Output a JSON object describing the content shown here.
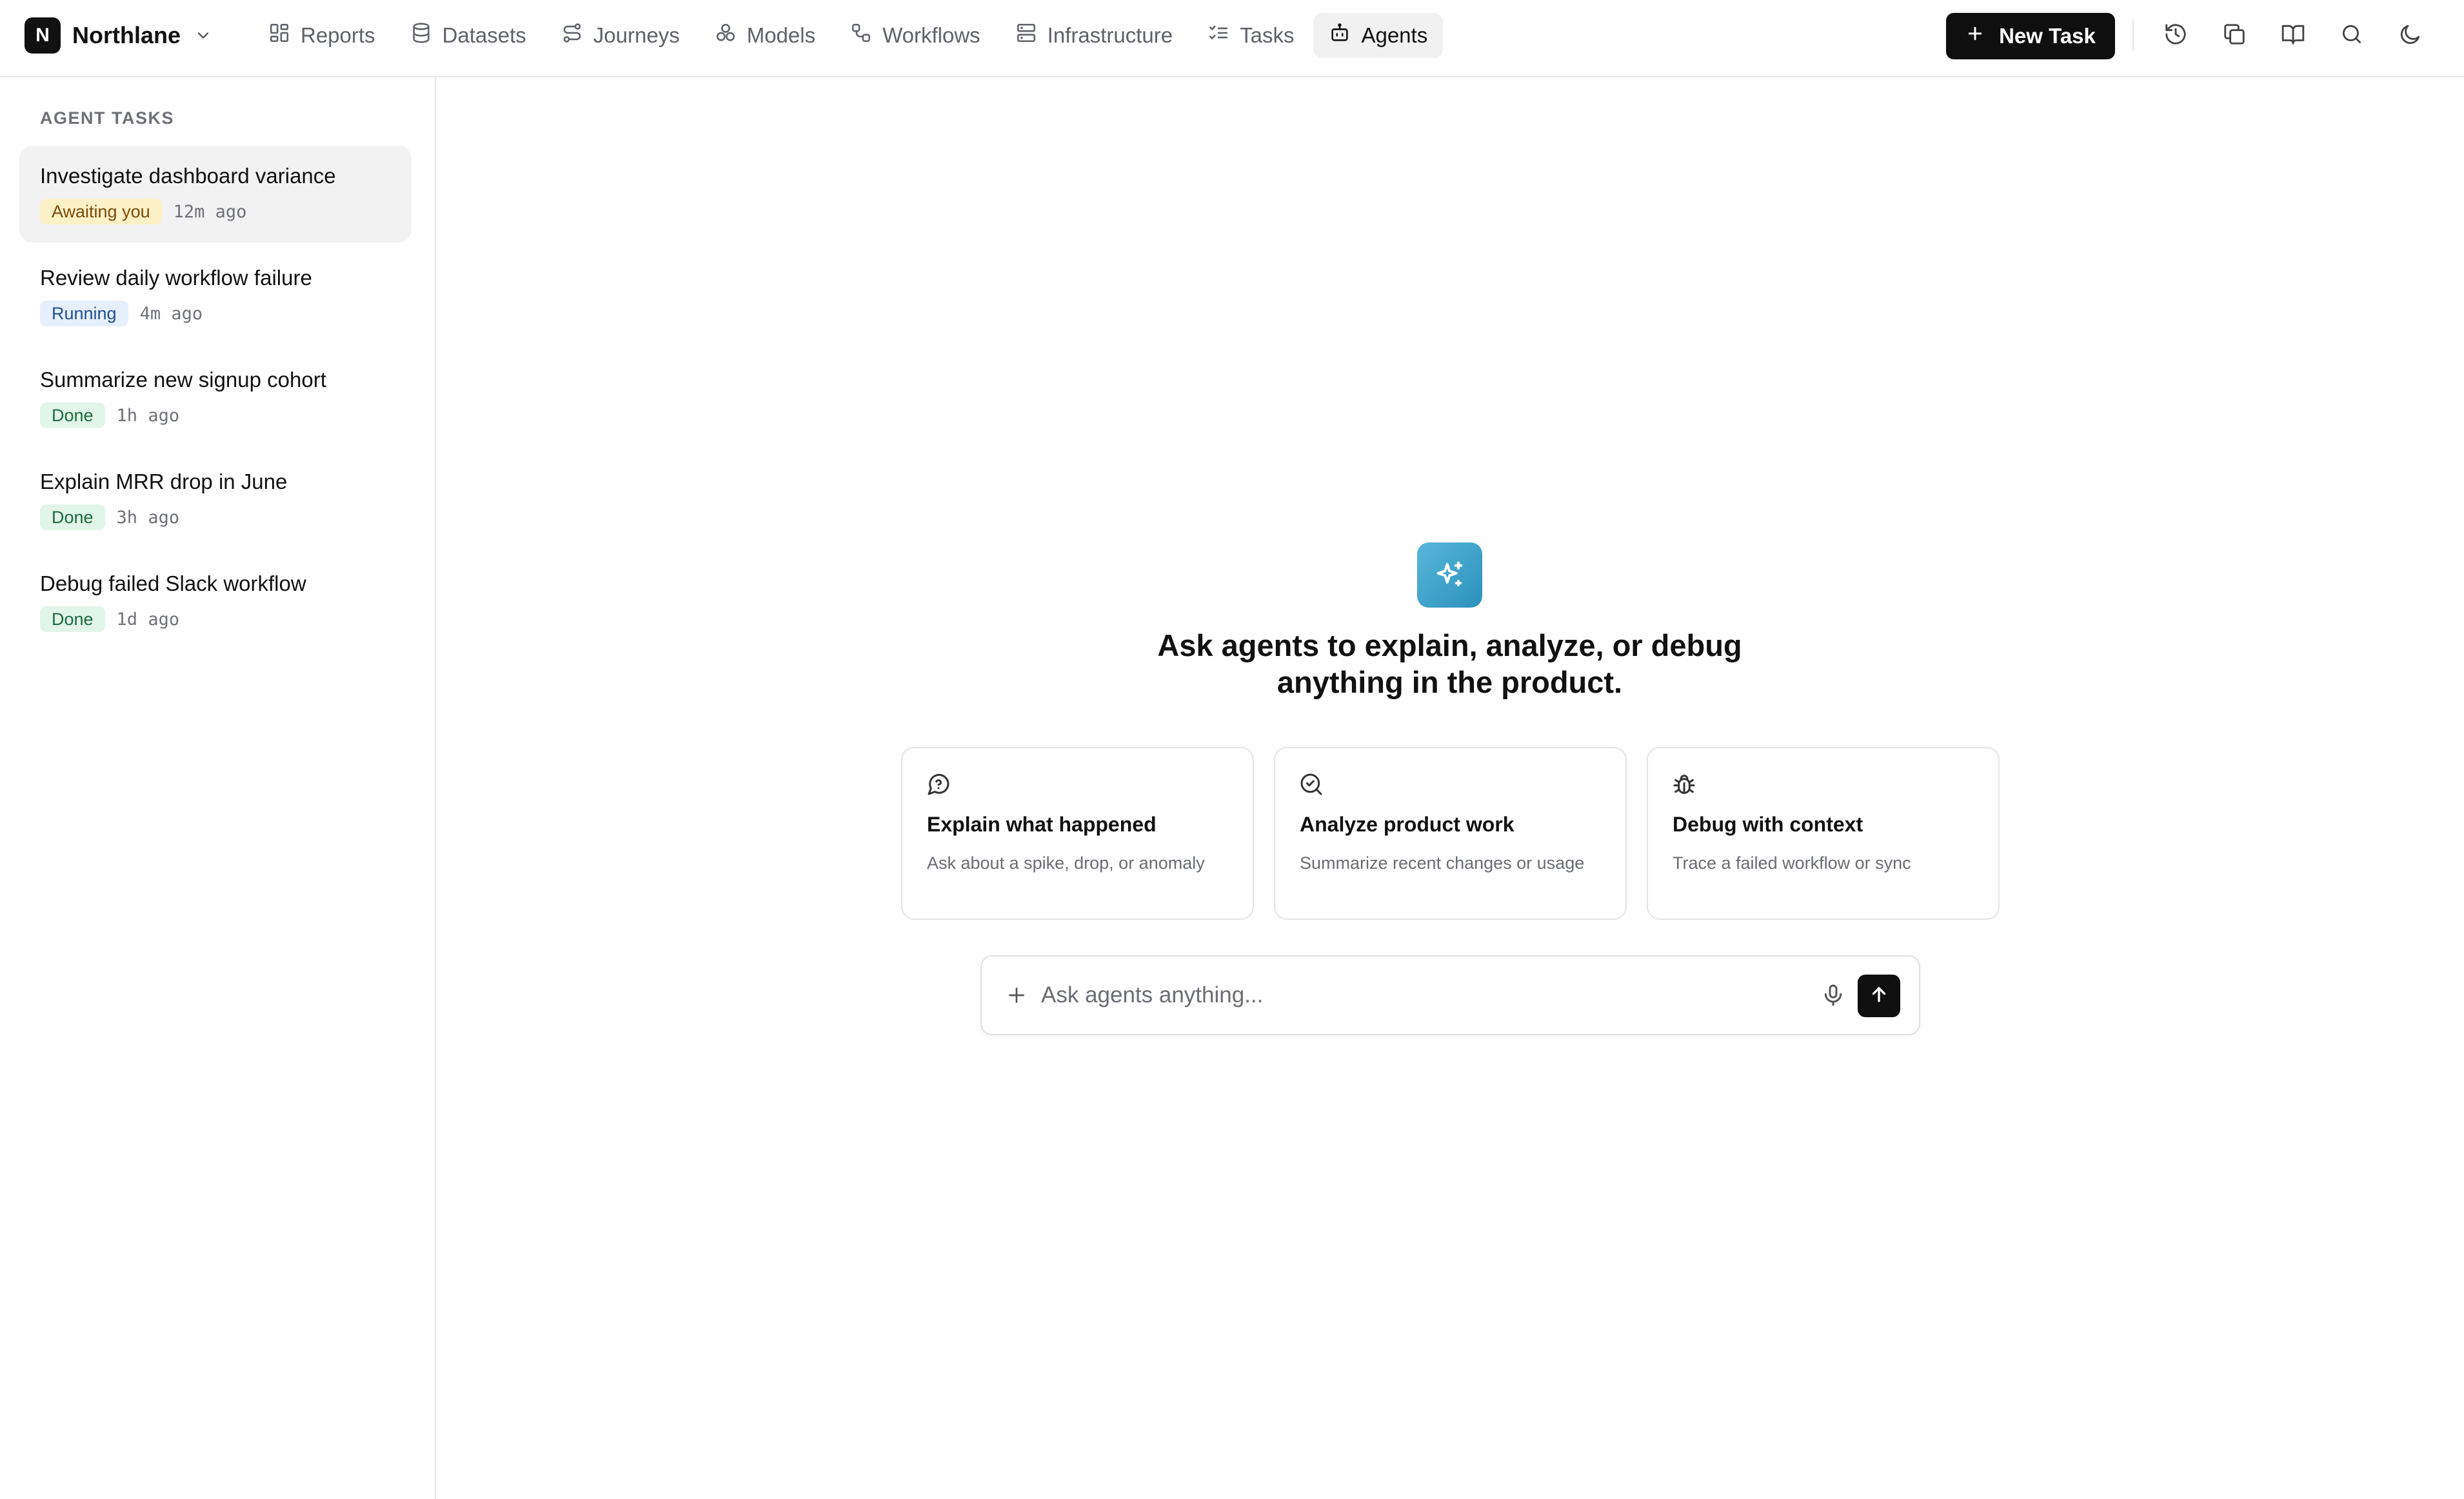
{
  "brand": {
    "initial": "N",
    "name": "Northlane"
  },
  "nav": [
    {
      "label": "Reports",
      "icon": "grid-icon"
    },
    {
      "label": "Datasets",
      "icon": "database-icon"
    },
    {
      "label": "Journeys",
      "icon": "route-icon"
    },
    {
      "label": "Models",
      "icon": "boxes-icon"
    },
    {
      "label": "Workflows",
      "icon": "workflow-icon"
    },
    {
      "label": "Infrastructure",
      "icon": "server-icon"
    },
    {
      "label": "Tasks",
      "icon": "list-checks-icon"
    },
    {
      "label": "Agents",
      "icon": "bot-icon",
      "active": true
    }
  ],
  "toolbar": {
    "new_task_label": "New Task",
    "icons": [
      "history-icon",
      "copy-icon",
      "book-icon",
      "search-icon",
      "moon-icon"
    ]
  },
  "sidebar": {
    "title": "AGENT TASKS",
    "tasks": [
      {
        "title": "Investigate dashboard variance",
        "status": "Awaiting you",
        "time": "12m ago"
      },
      {
        "title": "Review daily workflow failure",
        "status": "Running",
        "time": "4m ago"
      },
      {
        "title": "Summarize new signup cohort",
        "status": "Done",
        "time": "1h ago"
      },
      {
        "title": "Explain MRR drop in June",
        "status": "Done",
        "time": "3h ago"
      },
      {
        "title": "Debug failed Slack workflow",
        "status": "Done",
        "time": "1d ago"
      }
    ]
  },
  "main": {
    "hero_icon": "sparkles-icon",
    "hero_gradient": [
      "#59b6d9",
      "#2a92bd"
    ],
    "headline": "Ask agents to explain, analyze, or debug anything in the product.",
    "cards": [
      {
        "icon": "message-question-icon",
        "title": "Explain what happened",
        "desc": "Ask about a spike, drop, or anomaly"
      },
      {
        "icon": "search-check-icon",
        "title": "Analyze product work",
        "desc": "Summarize recent changes or usage"
      },
      {
        "icon": "bug-icon",
        "title": "Debug with context",
        "desc": "Trace a failed workflow or sync"
      }
    ],
    "composer": {
      "placeholder": "Ask agents anything..."
    }
  },
  "colors": {
    "accent": "#0f0f10",
    "awaiting_bg": "#fdf1c7",
    "running_bg": "#e6effc",
    "done_bg": "#e1f5e9"
  }
}
